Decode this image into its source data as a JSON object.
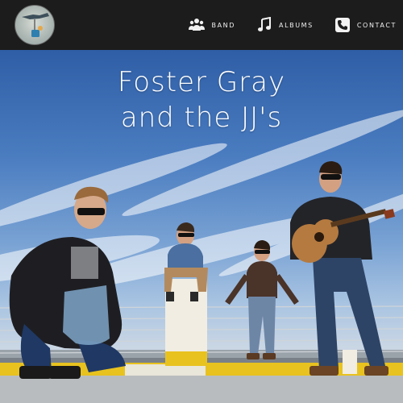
{
  "nav": {
    "items": [
      {
        "label": "BAND",
        "icon": "group-icon"
      },
      {
        "label": "ALBUMS",
        "icon": "music-note-icon"
      },
      {
        "label": "CONTACT",
        "icon": "phone-icon"
      }
    ]
  },
  "hero": {
    "title_line1": "Foster Gray",
    "title_line2": "and the JJ's"
  },
  "colors": {
    "navbar": "#1c1c1c",
    "nav_text": "#f0f0f0",
    "sky_top": "#2f5ea6",
    "railing_yellow": "#e8c21f"
  }
}
